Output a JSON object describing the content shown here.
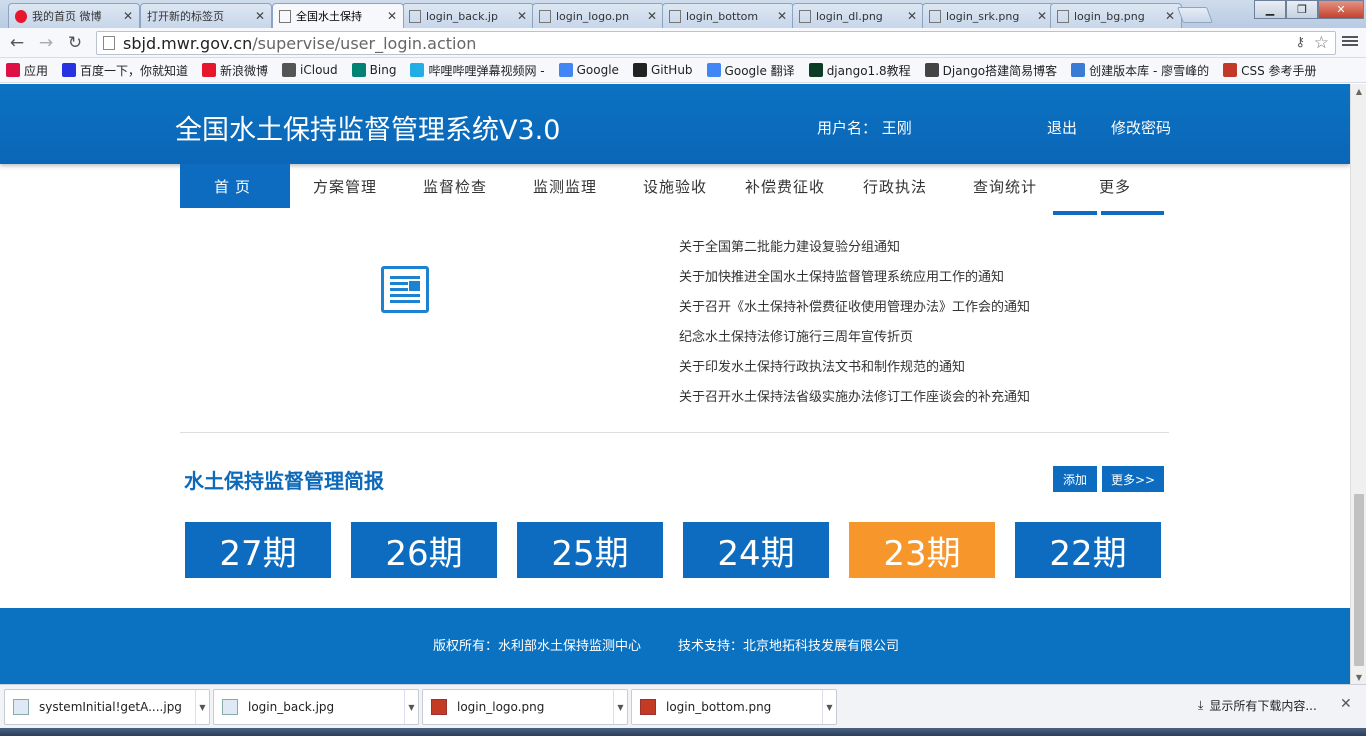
{
  "browser": {
    "tabs": [
      {
        "title": "我的首页 微博",
        "icon": "weibo-icon"
      },
      {
        "title": "打开新的标签页",
        "icon": "none"
      },
      {
        "title": "全国水土保持",
        "icon": "page-icon"
      },
      {
        "title": "login_back.jp",
        "icon": "page-icon"
      },
      {
        "title": "login_logo.pn",
        "icon": "page-icon"
      },
      {
        "title": "login_bottom",
        "icon": "page-icon"
      },
      {
        "title": "login_dl.png",
        "icon": "page-icon"
      },
      {
        "title": "login_srk.png",
        "icon": "page-icon"
      },
      {
        "title": "login_bg.png",
        "icon": "page-icon"
      }
    ],
    "url_host": "sbjd.mwr.gov.cn",
    "url_path": "/supervise/user_login.action",
    "bookmarks": [
      {
        "label": "应用",
        "color": "#d14"
      },
      {
        "label": "百度一下，你就知道",
        "color": "#2932e1"
      },
      {
        "label": "新浪微博",
        "color": "#e6162d"
      },
      {
        "label": "iCloud",
        "color": "#555555"
      },
      {
        "label": "Bing",
        "color": "#008373"
      },
      {
        "label": "哔哩哔哩弹幕视频网 -",
        "color": "#23ade5"
      },
      {
        "label": "Google",
        "color": "#4285f4"
      },
      {
        "label": "GitHub",
        "color": "#222222"
      },
      {
        "label": "Google 翻译",
        "color": "#4285f4"
      },
      {
        "label": "django1.8教程",
        "color": "#0c3c26"
      },
      {
        "label": "Django搭建简易博客",
        "color": "#444444"
      },
      {
        "label": "创建版本库 - 廖雪峰的",
        "color": "#3a7bd5"
      },
      {
        "label": "CSS 参考手册",
        "color": "#c0392b"
      }
    ]
  },
  "header": {
    "title": "全国水土保持监督管理系统V3.0",
    "user_label": "用户名： 王刚",
    "logout": "退出",
    "change_password": "修改密码"
  },
  "nav": {
    "items": [
      "首页",
      "方案管理",
      "监督检查",
      "监测监理",
      "设施验收",
      "补偿费征收",
      "行政执法",
      "查询统计",
      "更多"
    ],
    "active_index": 0
  },
  "notices": [
    "关于全国第二批能力建设复验分组通知",
    "关于加快推进全国水土保持监督管理系统应用工作的通知",
    "关于召开《水土保持补偿费征收使用管理办法》工作会的通知",
    "纪念水土保持法修订施行三周年宣传折页",
    "关于印发水土保持行政执法文书和制作规范的通知",
    "关于召开水土保持法省级实施办法修订工作座谈会的补充通知"
  ],
  "brief": {
    "title": "水土保持监督管理简报",
    "add_button": "添加",
    "more_button": "更多>>",
    "issues": [
      "27期",
      "26期",
      "25期",
      "24期",
      "23期",
      "22期"
    ],
    "highlight_index": 4,
    "colors": {
      "issue": "#0d6cc0",
      "highlight": "#f7962b"
    }
  },
  "footer": {
    "copyright": "版权所有：水利部水土保持监测中心",
    "support": "技术支持：北京地拓科技发展有限公司"
  },
  "downloads": {
    "items": [
      {
        "name": "systemInitial!getA....jpg",
        "type": "jpg"
      },
      {
        "name": "login_back.jpg",
        "type": "jpg"
      },
      {
        "name": "login_logo.png",
        "type": "png"
      },
      {
        "name": "login_bottom.png",
        "type": "png"
      }
    ],
    "show_all": "显示所有下载内容..."
  }
}
